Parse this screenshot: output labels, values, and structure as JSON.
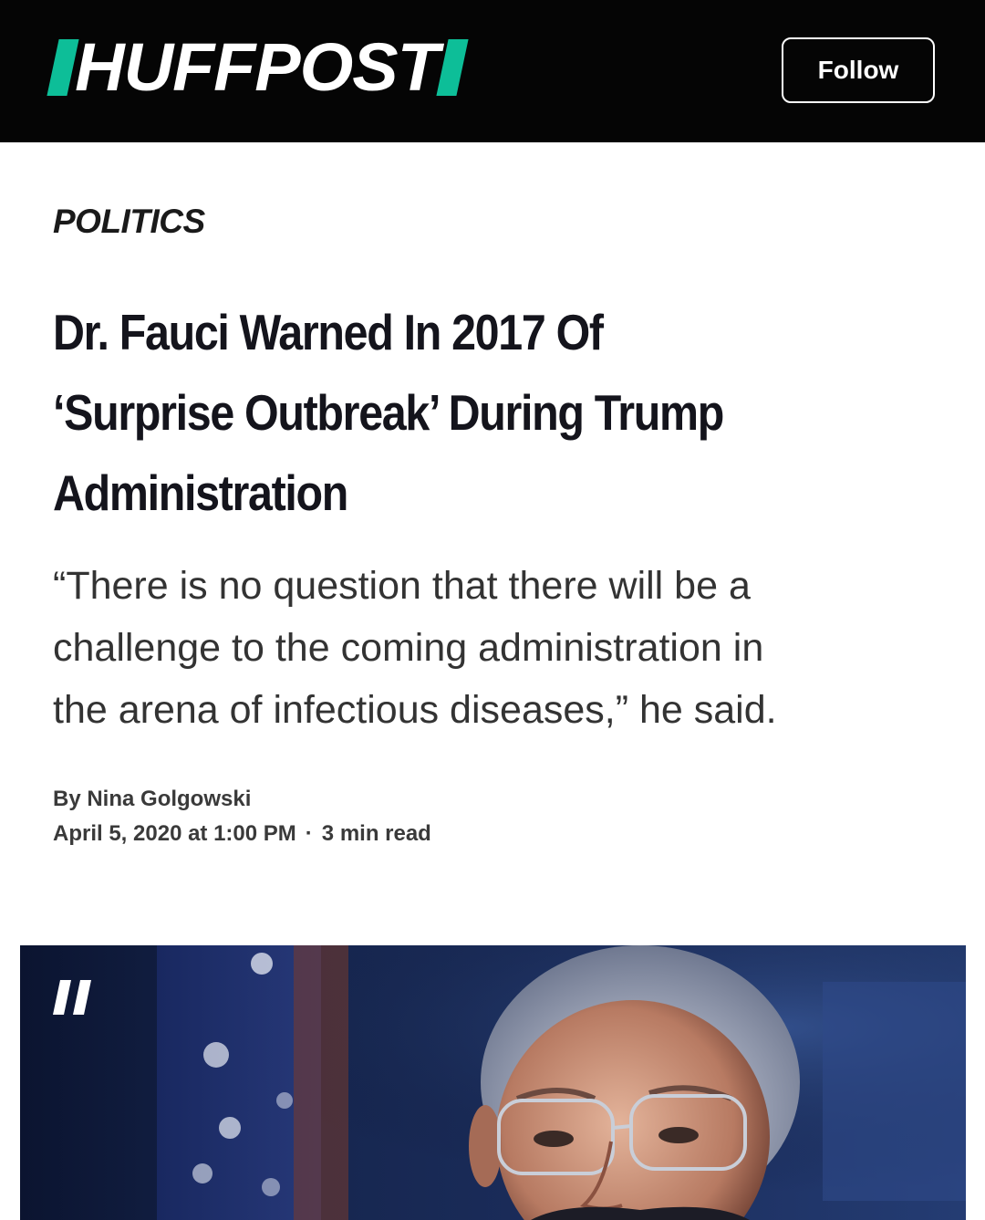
{
  "header": {
    "logo_text": "HUFFPOST",
    "follow_label": "Follow",
    "accent_color": "#0dbe98"
  },
  "article": {
    "section": "POLITICS",
    "headline_lines": [
      "Dr. Fauci Warned In 2017 Of",
      "‘Surprise Outbreak’ During Trump",
      "Administration"
    ],
    "dek_lines": [
      "“There is no question that there will be a",
      "challenge to the coming administration in",
      "the arena of infectious diseases,” he said."
    ],
    "byline": "By Nina Golgowski",
    "date": "April 5, 2020 at 1:00 PM",
    "separator": "·",
    "read_time": "3 min read"
  },
  "hero": {
    "badge_icon": "huffpost-quote-icon",
    "subject_description_icon": "portrait-photo"
  }
}
